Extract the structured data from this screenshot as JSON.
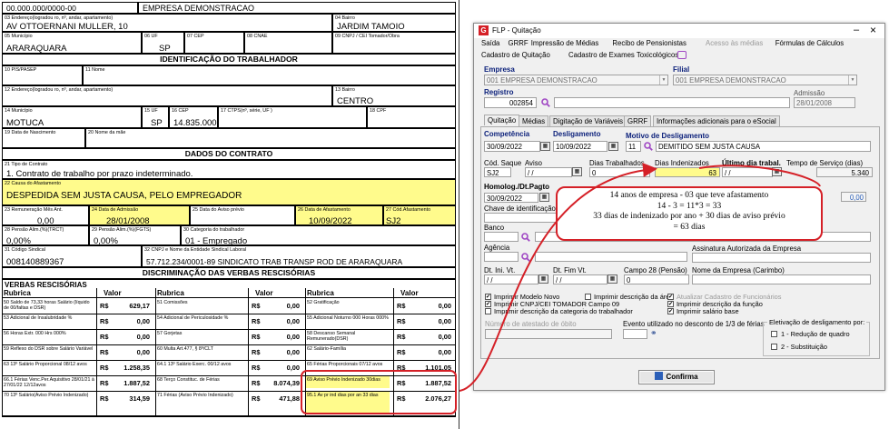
{
  "trct": {
    "cnpj": "00.000.000/0000-00",
    "company": "EMPRESA DEMONSTRACAO",
    "address_label": "03 Endereço(logradou ro, nº, andar, apartamento)",
    "address": "AV OTTOERNANI MULLER, 10",
    "bairro_label": "04 Bairro",
    "bairro": "JARDIM TAMOIO",
    "mun_label": "05 Município",
    "mun": "ARARAQUARA",
    "uf_label": "06 UF",
    "uf": "SP",
    "cep_label": "07 CEP",
    "cnae_label": "08 CNAE",
    "tomador_label": "09 CNPJ / CEI Tomador/Obra",
    "sec_trab": "IDENTIFICAÇÃO DO TRABALHADOR",
    "pis_label": "10 PIS/PASEP",
    "nome_label": "11 Nome",
    "end2_label": "12 Endereço(logradou ro, nº, andar, apartamento)",
    "bairro2_label": "13 Bairro",
    "bairro2": "CENTRO",
    "mun2_label": "14 Município",
    "mun2": "MOTUCA",
    "uf2_label": "15 UF",
    "uf2": "SP",
    "cep2_label": "16 CEP",
    "cep2": "14.835.000",
    "ctps_label": "17 CTPS(nº, série, UF )",
    "cpf_label": "18 CPF",
    "nasc_label": "19 Data de Nascimento",
    "mae_label": "20 Nome da mãe",
    "sec_contrato": "DADOS DO CONTRATO",
    "tipo_label": "21 Tipo de Contrato",
    "tipo": "1. Contrato de trabalho por prazo indeterminado.",
    "causa_label": "22 Causa do Afastamento",
    "causa": "DESPEDIDA SEM JUSTA CAUSA, PELO EMPREGADOR",
    "rem_label": "23 Remuneração Mês Ant.",
    "rem": "0,00",
    "adm_label": "24 Data de Admissão",
    "adm": "28/01/2008",
    "aviso_label": "25 Data do Aviso prévio",
    "afast_label": "26 Data de Afastamento",
    "afast": "10/09/2022",
    "cod_label": "27 Cód.Afastamento",
    "cod": "SJ2",
    "pen1_label": "28 Pensão Alim.(%)(TRCT)",
    "pen1": "0,00%",
    "pen2_label": "29 Pensão Alim.(%)(FGTS)",
    "pen2": "0,00%",
    "cat_label": "30 Categoria do trabalhador",
    "cat": "01 - Empregado",
    "sind_label": "31 Código Sindical",
    "sind": "008140889367",
    "ent_label": "32 CNPJ e Nome da Entidade Sindical Laboral",
    "ent": "57.712.234/0001-89 SINDICATO TRAB TRANSP ROD DE ARARAQUARA",
    "sec_verbas": "DISCRIMINAÇÃO  DAS VERBAS RESCISÓRIAS",
    "verbas_title": "VERBAS RESCISÓRIAS",
    "col_rubrica": "Rubrica",
    "col_valor": "Valor",
    "currency": "R$",
    "rows": [
      [
        {
          "l": "50 Saldo de 73,33 horas Salário (líquido de 00/faltas e DSR)",
          "v": "629,17"
        },
        {
          "l": "51 Comissões",
          "v": "0,00"
        },
        {
          "l": "52 Gratificação",
          "v": "0,00"
        }
      ],
      [
        {
          "l": "53 Adicional de Insalubridade %",
          "v": "0,00"
        },
        {
          "l": "54 Adicional de Periculosidade %",
          "v": "0,00"
        },
        {
          "l": "55 Adicional Noturno 000 Horas 000%",
          "v": "0,00"
        }
      ],
      [
        {
          "l": "56 Horas Extr. 000 Hrs 000%",
          "v": "0,00"
        },
        {
          "l": "57 Gorjetas",
          "v": "0,00"
        },
        {
          "l": "58 Descanso Semanal Remunerado(DSR)",
          "v": "0,00"
        }
      ],
      [
        {
          "l": "59 Reflexo do DSR sobre Salário Variável",
          "v": "0,00"
        },
        {
          "l": "60 Multa Art.477, § 8º/CLT",
          "v": "0,00"
        },
        {
          "l": "62 Salário-Família",
          "v": "0,00"
        }
      ],
      [
        {
          "l": "63 13º Salário Proporcional 08/12 avos",
          "v": "1.258,35"
        },
        {
          "l": "64.1 13º Salário Exerc.      00/12 avos",
          "v": "0,00"
        },
        {
          "l": "65 Férias Proporcionais 07/12 avos",
          "v": "1.101,05"
        }
      ],
      [
        {
          "l": "66.1 Férias Venc.Per.Aquisitivo 28/01/21 à 27/01/22 12/12avos",
          "v": "1.887,52"
        },
        {
          "l": "68 Terço Constituc. de Férias",
          "v": "8.074,39"
        },
        {
          "l": "69 Aviso Prévio Indenizado 30dias",
          "v": "1.887,52"
        }
      ],
      [
        {
          "l": "70 13º Salário(Aviso Prévio Indenizado)",
          "v": "314,59"
        },
        {
          "l": "71 Férias (Aviso Prévio Indenizado)",
          "v": "471,88"
        },
        {
          "l": "95.1 Av pr ind dias por an 33 dias",
          "v": "2.076,27"
        }
      ]
    ]
  },
  "app": {
    "title": "FLP - Quitação",
    "menu": [
      "Saída",
      "GRRF",
      "Impressão de Médias",
      "Recibo de Pensionistas",
      "Acesso às médias",
      "Fórmulas de Cálculos"
    ],
    "menu2": [
      "Cadastro de Quitação",
      "Cadastro de Exames Toxicológicos"
    ],
    "empresa_label": "Empresa",
    "empresa": "001 EMPRESA DEMONSTRACAO",
    "filial_label": "Filial",
    "filial": "001 EMPRESA DEMONSTRACAO",
    "registro_label": "Registro",
    "registro": "002854",
    "admissao_label": "Admissão",
    "admissao": "28/01/2008",
    "tabs": [
      "Quitação",
      "Médias",
      "Digitação de Variáveis",
      "GRRF",
      "Informações adicionais para o eSocial"
    ],
    "competencia_label": "Competência",
    "competencia": "30/09/2022",
    "deslig_label": "Desligamento",
    "deslig": "10/09/2022",
    "motivo_label": "Motivo de Desligamento",
    "motivo_code": "11",
    "motivo": "DEMITIDO SEM JUSTA CAUSA",
    "codsaque_label": "Cód. Saque",
    "codsaque": "SJ2",
    "aviso_label": "Aviso",
    "aviso": "/ /",
    "diastrab_label": "Dias Trabalhados",
    "diastrab": "0",
    "diasind_label": "Dias Indenizados",
    "diasind": "63",
    "ultimo_label": "Último dia trabal.",
    "ultimo": "/ /",
    "tempo_label": "Tempo de Serviço (dias)",
    "tempo": "5.340",
    "homolog_label": "Homolog./Dt.Pagto",
    "homolog": "30/09/2022",
    "aux_value": "0,00",
    "chave_label": "Chave de identificação",
    "banco_label": "Banco",
    "agencia_label": "Agência",
    "assinatura_label": "Assinatura Autorizada da Empresa",
    "dtini_label": "Dt. Ini. Vt.",
    "dtini": "/ /",
    "dtfim_label": "Dt. Fim Vt.",
    "dtfim": "/ /",
    "campo28_label": "Campo 28 (Pensão)",
    "campo28": "0",
    "nomeemp_label": "Nome da Empresa (Carimbo)",
    "checks": [
      {
        "label": "Imprimir Modelo Novo",
        "checked": "✔",
        "disabled": false
      },
      {
        "label": "Imprimir descrição da área",
        "checked": "",
        "disabled": false
      },
      {
        "label": "Atualizar Cadastro de Funcionários",
        "checked": "✔",
        "disabled": true
      },
      {
        "label": "Imprimir CNPJ/CEI TOMADOR Campo 09",
        "checked": "✔",
        "disabled": false
      },
      {
        "label": "Imprimir descrição da função",
        "checked": "✔",
        "disabled": false
      },
      {
        "label": "Imprimir descrição da categoria do trabalhador",
        "checked": "",
        "disabled": false
      },
      {
        "label": "Imprimir salário base",
        "checked": "✔",
        "disabled": false
      }
    ],
    "atestado_label": "Número de atestado de óbito",
    "evento_label": "Evento utilizado no desconto de 1/3 de férias",
    "eletivacao_label": "Eletivação de desligamento por:",
    "opt1": "1 - Redução de quadro",
    "opt2": "2 - Substituição",
    "confirm_label": "Confirma"
  },
  "annotation": {
    "line1": "14 anos de empresa - 03 que teve afastamento",
    "line2": "14 - 3 = 11*3 = 33",
    "line3": "33 dias de indenizado por ano + 30 dias de aviso prévio",
    "line4": "= 63 dias"
  },
  "colors": {
    "highlight": "#fffb8c",
    "annotation": "#d52027",
    "label_blue": "#0a1f7a"
  }
}
